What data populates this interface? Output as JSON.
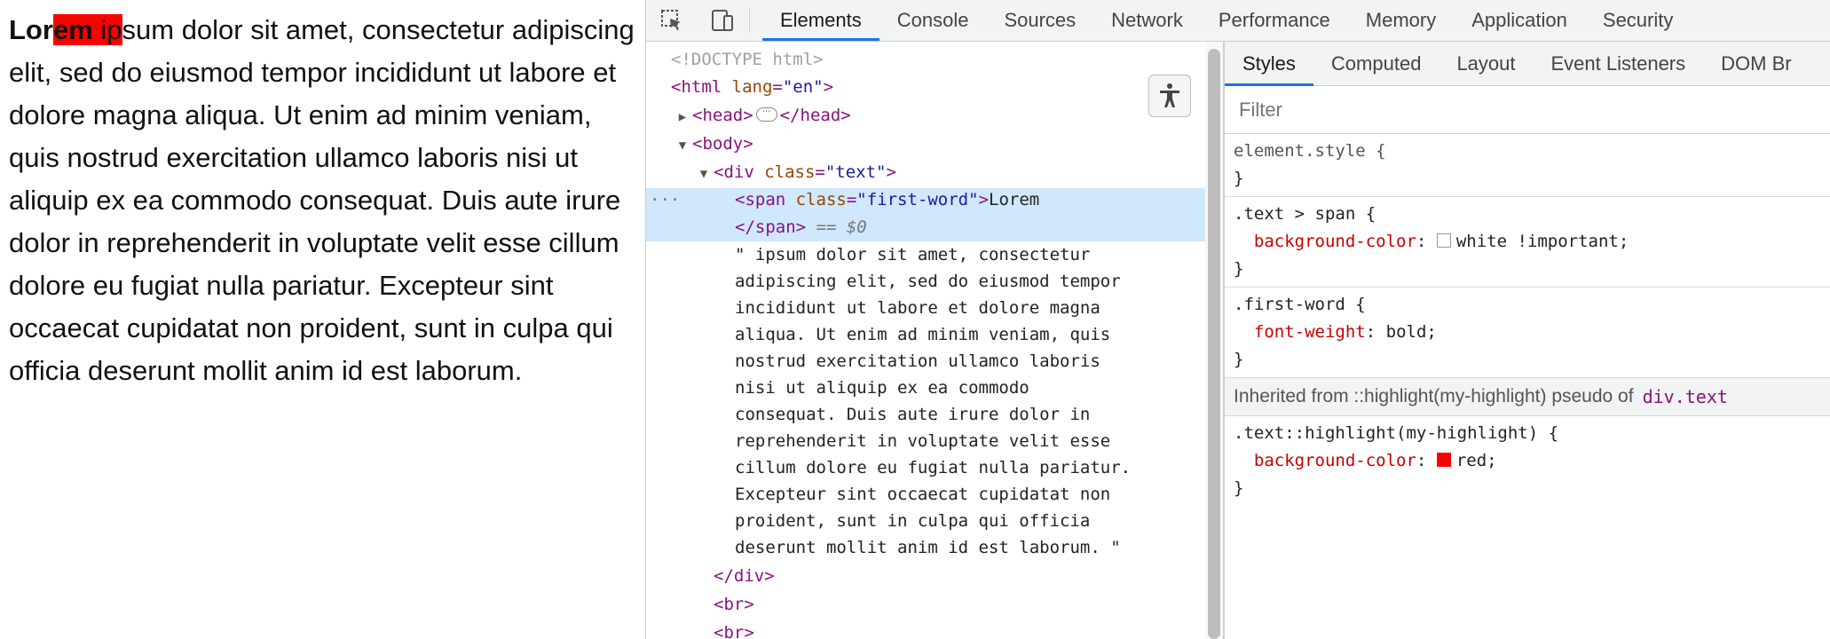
{
  "preview": {
    "first_word_bold": "Lor",
    "first_word_highlight": "em",
    "space": " ",
    "rest_highlight": "ip",
    "rest": "sum dolor sit amet, consectetur adipiscing elit, sed do eiusmod tempor incididunt ut labore et dolore magna aliqua. Ut enim ad minim veniam, quis nostrud exercitation ullamco laboris nisi ut aliquip ex ea commodo consequat. Duis aute irure dolor in reprehenderit in voluptate velit esse cillum dolore eu fugiat nulla pariatur. Excepteur sint occaecat cupidatat non proident, sunt in culpa qui officia deserunt mollit anim id est laborum.",
    "highlight_color": "#ff0000"
  },
  "toolbar": {
    "tabs": [
      "Elements",
      "Console",
      "Sources",
      "Network",
      "Performance",
      "Memory",
      "Application",
      "Security"
    ],
    "active_tab": "Elements"
  },
  "elements": {
    "doctype": "<!DOCTYPE html>",
    "html_open_tag": "<html",
    "html_attr": " lang",
    "html_eq": "=",
    "html_val": "\"en\"",
    "html_close": ">",
    "head_open": "<head>",
    "head_close": "</head>",
    "body_open": "<body>",
    "div_open": "<div",
    "div_attr": " class",
    "div_eq": "=",
    "div_val": "\"text\"",
    "div_close": ">",
    "span_open": "<span",
    "span_attr": " class",
    "span_eq": "=",
    "span_val": "\"first-word\"",
    "span_gt": ">",
    "span_text": "Lorem",
    "span_close": "</span>",
    "eq_dollar_prefix": " == ",
    "dollar_zero": "$0",
    "text_lines": [
      "\" ipsum dolor sit amet, consectetur",
      "adipiscing elit, sed do eiusmod tempor",
      "incididunt ut labore et dolore magna",
      "aliqua. Ut enim ad minim veniam, quis",
      "nostrud exercitation ullamco laboris",
      "nisi ut aliquip ex ea commodo",
      "consequat. Duis aute irure dolor in",
      "reprehenderit in voluptate velit esse",
      "cillum dolore eu fugiat nulla pariatur.",
      "Excepteur sint occaecat cupidatat non",
      "proident, sunt in culpa qui officia",
      "deserunt mollit anim id est laborum. \""
    ],
    "div_end": "</div>",
    "br1": "<br>",
    "br2": "<br>",
    "row_dots": "···",
    "collapsed_dots": "···"
  },
  "styles": {
    "subtabs": [
      "Styles",
      "Computed",
      "Layout",
      "Event Listeners",
      "DOM Br"
    ],
    "active_subtab": "Styles",
    "filter_placeholder": "Filter",
    "element_style": "element.style {",
    "close_brace": "}",
    "rule1_selector": ".text > span {",
    "rule1_prop": "background-color",
    "rule1_colon": ": ",
    "rule1_value": "white !important",
    "rule1_end": ";",
    "rule1_swatch": "#ffffff",
    "rule2_selector": ".first-word {",
    "rule2_prop": "font-weight",
    "rule2_colon": ": ",
    "rule2_value": "bold",
    "rule2_end": ";",
    "inherited_label": "Inherited from ::highlight(my-highlight) pseudo of",
    "inherited_link": "div.text",
    "rule3_selector": ".text::highlight(my-highlight) {",
    "rule3_prop": "background-color",
    "rule3_colon": ": ",
    "rule3_value": "red",
    "rule3_end": ";",
    "rule3_swatch": "#ff0000"
  }
}
